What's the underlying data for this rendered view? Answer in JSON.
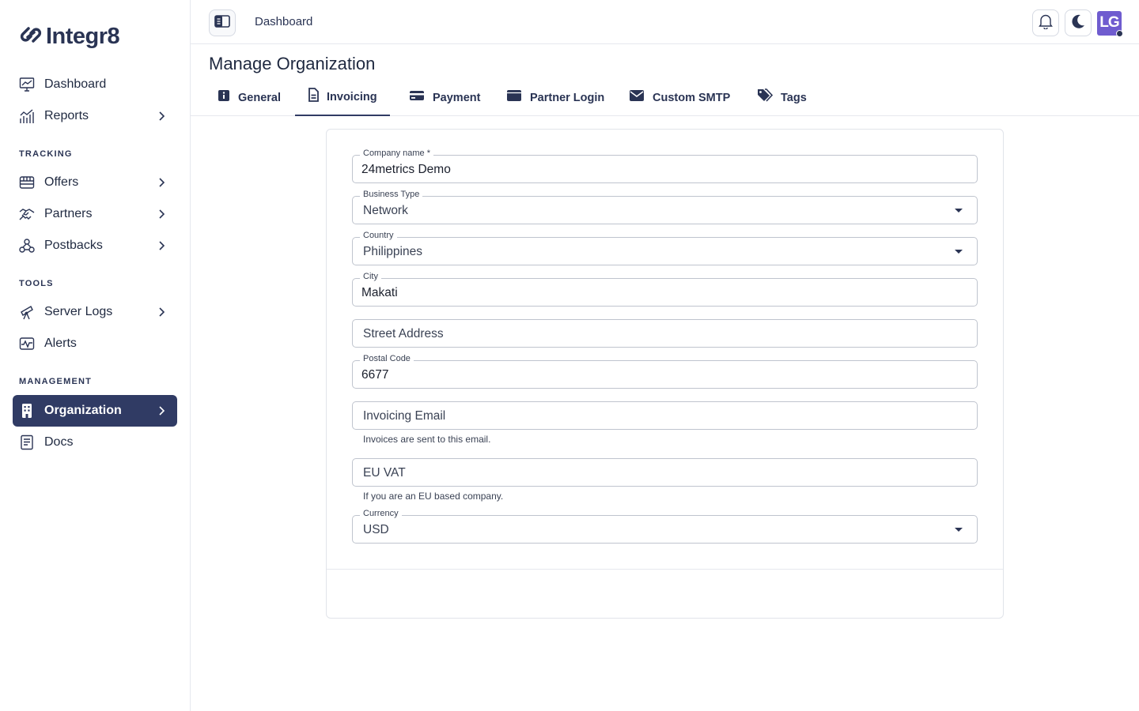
{
  "app": {
    "name": "Integr8"
  },
  "sidebar": {
    "top_items": [
      {
        "label": "Dashboard",
        "icon": "dashboard-chart-icon"
      },
      {
        "label": "Reports",
        "icon": "reports-bars-icon"
      }
    ],
    "sections": [
      {
        "title": "TRACKING",
        "items": [
          {
            "label": "Offers",
            "icon": "offers-icon"
          },
          {
            "label": "Partners",
            "icon": "handshake-icon"
          },
          {
            "label": "Postbacks",
            "icon": "webhook-icon"
          }
        ]
      },
      {
        "title": "TOOLS",
        "items": [
          {
            "label": "Server Logs",
            "icon": "telescope-icon"
          },
          {
            "label": "Alerts",
            "icon": "pulse-icon"
          }
        ]
      },
      {
        "title": "MANAGEMENT",
        "items": [
          {
            "label": "Organization",
            "icon": "building-icon",
            "active": true
          },
          {
            "label": "Docs",
            "icon": "docs-icon"
          }
        ]
      }
    ]
  },
  "header": {
    "breadcrumb": "Dashboard",
    "avatar_initials": "LG"
  },
  "page": {
    "title": "Manage Organization"
  },
  "tabs": [
    {
      "label": "General",
      "icon": "info-icon"
    },
    {
      "label": "Invoicing",
      "icon": "file-icon",
      "active": true
    },
    {
      "label": "Payment",
      "icon": "credit-card-icon"
    },
    {
      "label": "Partner Login",
      "icon": "window-icon"
    },
    {
      "label": "Custom SMTP",
      "icon": "envelope-icon"
    },
    {
      "label": "Tags",
      "icon": "tags-icon"
    }
  ],
  "form": {
    "company_name": {
      "label": "Company name *",
      "value": "24metrics Demo"
    },
    "business_type": {
      "label": "Business Type",
      "value": "Network"
    },
    "country": {
      "label": "Country",
      "value": "Philippines"
    },
    "city": {
      "label": "City",
      "value": "Makati"
    },
    "street_address": {
      "placeholder": "Street Address"
    },
    "postal_code": {
      "label": "Postal Code",
      "value": "6677"
    },
    "invoicing_email": {
      "placeholder": "Invoicing Email",
      "helper": "Invoices are sent to this email."
    },
    "eu_vat": {
      "placeholder": "EU VAT",
      "helper": "If you are an EU based company."
    },
    "currency": {
      "label": "Currency",
      "value": "USD"
    }
  },
  "colors": {
    "accent": "#303b64",
    "avatar": "#6f5ccf",
    "text": "#1f2940"
  }
}
